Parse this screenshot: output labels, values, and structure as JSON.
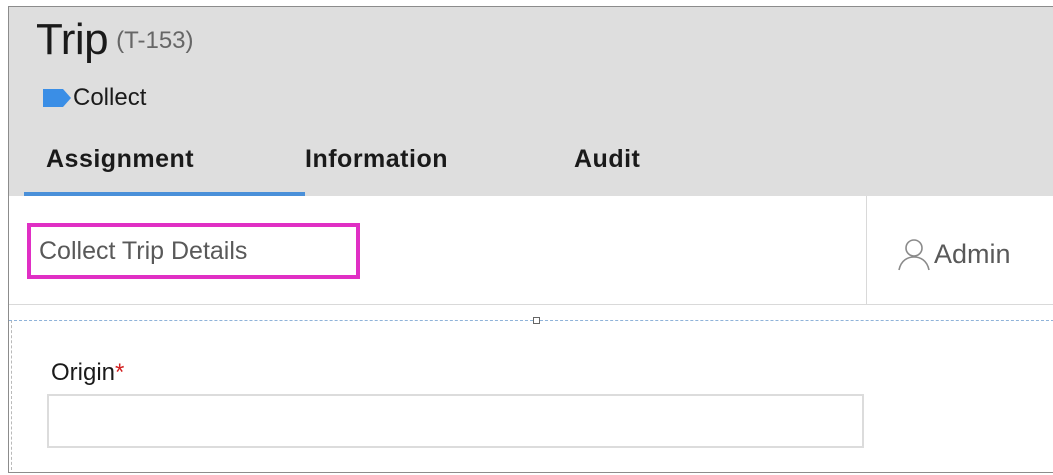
{
  "header": {
    "title": "Trip",
    "trip_id": "(T-153)",
    "stage": {
      "icon": "stage-tag-icon",
      "label": "Collect",
      "color": "#3a8ee6"
    }
  },
  "tabs": [
    {
      "label": "Assignment",
      "active": true
    },
    {
      "label": "Information",
      "active": false
    },
    {
      "label": "Audit",
      "active": false
    }
  ],
  "panel": {
    "step_title": "Collect Trip Details",
    "assignee": {
      "icon": "user-icon",
      "label": "Admin"
    }
  },
  "form": {
    "origin": {
      "label": "Origin",
      "required_marker": "*",
      "value": ""
    }
  },
  "colors": {
    "header_bg": "#dedede",
    "active_tab_underline": "#4a90d9",
    "highlight_border": "#e02fc4",
    "required": "#d21f1f"
  }
}
